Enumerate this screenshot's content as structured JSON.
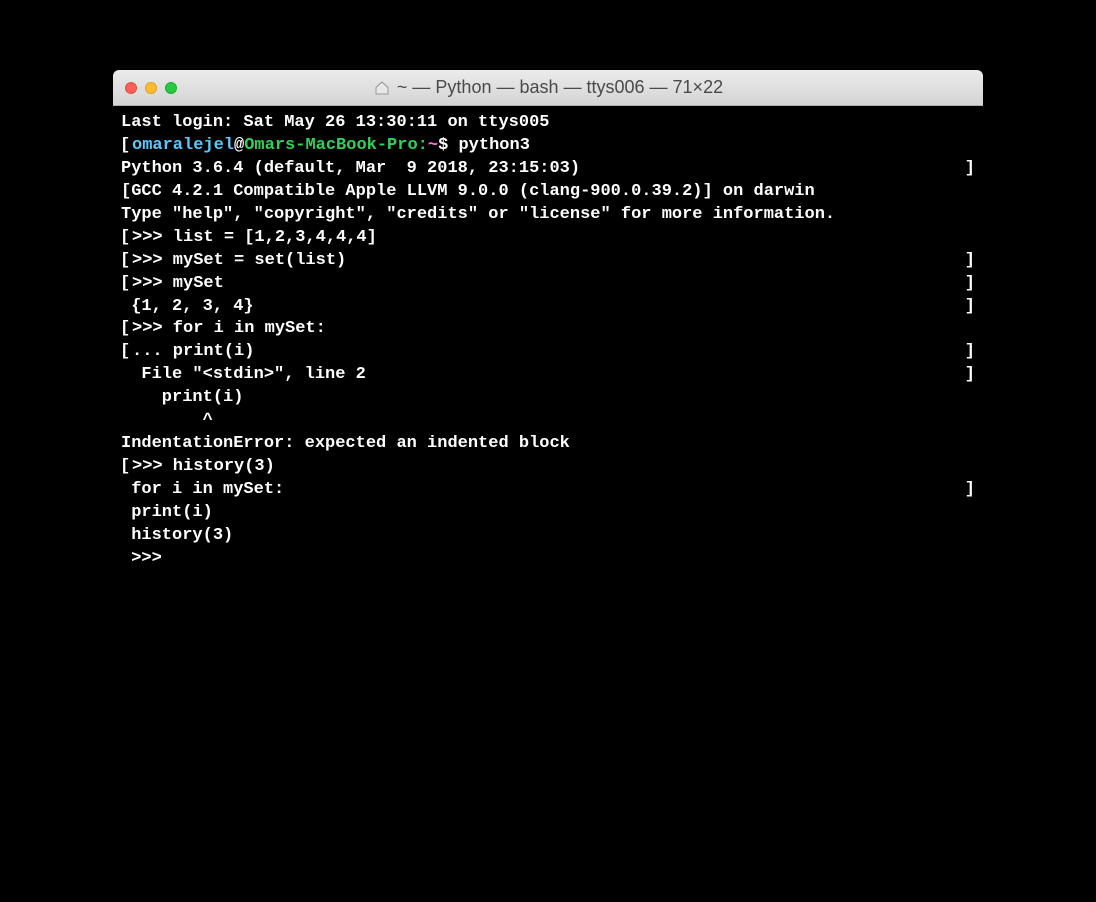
{
  "window": {
    "title": "~ — Python — bash — ttys006 — 71×22"
  },
  "prompt": {
    "user": "omaralejel",
    "at": "@",
    "host": "Omars-MacBook-Pro:",
    "path": "~",
    "sep": "$ ",
    "command": "python3"
  },
  "lines": {
    "last_login": "Last login: Sat May 26 13:30:11 on ttys005",
    "py_version": "Python 3.6.4 (default, Mar  9 2018, 23:15:03) ",
    "gcc": "[GCC 4.2.1 Compatible Apple LLVM 9.0.0 (clang-900.0.39.2)] on darwin",
    "help": "Type \"help\", \"copyright\", \"credits\" or \"license\" for more information.",
    "l1": ">>> list = [1,2,3,4,4,4]",
    "l2": ">>> mySet = set(list)",
    "l3": ">>> mySet",
    "l4": " {1, 2, 3, 4}",
    "l5": ">>> for i in mySet:",
    "l6": "... print(i)",
    "l7": "  File \"<stdin>\", line 2",
    "l8": "    print(i)",
    "l9": "        ^",
    "l10": "IndentationError: expected an indented block",
    "l11": ">>> history(3)",
    "l12": " for i in mySet:",
    "l13": " print(i)",
    "l14": " history(3)",
    "l15": " >>> "
  }
}
